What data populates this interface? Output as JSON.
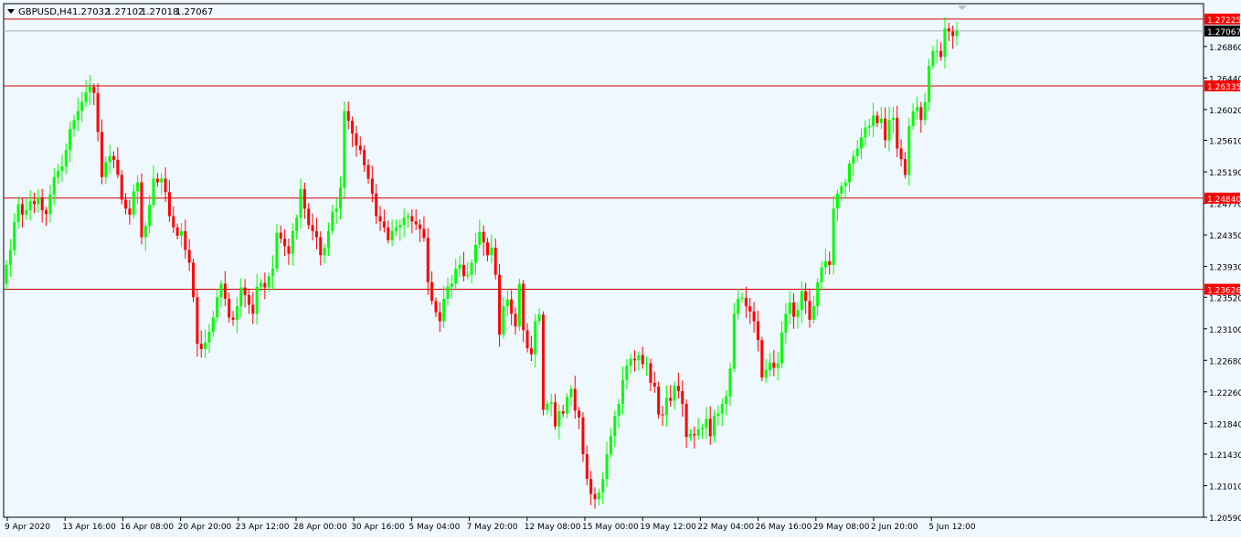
{
  "colors": {
    "background": "#F0F8FF",
    "frame": "#000000",
    "bull": "#00FF00",
    "bear": "#FF0000",
    "level_line": "#CC0000",
    "bid_line": "#B0B0B0",
    "text": "#000000"
  },
  "header": {
    "arrow_icon": "triangle-down-icon",
    "symbol": "GBPUSD,H4",
    "open": "1.27032",
    "high": "1.27102",
    "low": "1.27018",
    "close": "1.27067"
  },
  "chart_data": {
    "type": "candlestick",
    "symbol": "GBPUSD",
    "timeframe": "H4",
    "ylim": [
      1.2059,
      1.2743
    ],
    "y_ticks": [
      "1.26860",
      "1.26440",
      "1.26020",
      "1.25610",
      "1.25190",
      "1.24770",
      "1.24350",
      "1.23930",
      "1.23520",
      "1.23100",
      "1.22680",
      "1.22260",
      "1.21840",
      "1.21430",
      "1.21010",
      "1.20590"
    ],
    "x_labels": [
      "9 Apr 2020",
      "13 Apr 16:00",
      "16 Apr 08:00",
      "20 Apr 20:00",
      "23 Apr 12:00",
      "28 Apr 00:00",
      "30 Apr 16:00",
      "5 May 04:00",
      "7 May 20:00",
      "12 May 08:00",
      "15 May 00:00",
      "19 May 12:00",
      "22 May 04:00",
      "26 May 16:00",
      "29 May 08:00",
      "2 Jun 20:00",
      "5 Jun 12:00"
    ],
    "horizontal_levels": [
      "1.27225",
      "1.26335",
      "1.24840",
      "1.23626"
    ],
    "current_price": "1.27067",
    "closes": [
      1.2395,
      1.2415,
      1.2452,
      1.2476,
      1.2462,
      1.2468,
      1.248,
      1.2476,
      1.2485,
      1.2468,
      1.2463,
      1.2489,
      1.2512,
      1.252,
      1.2526,
      1.2548,
      1.2576,
      1.2588,
      1.26,
      1.2612,
      1.2625,
      1.2632,
      1.2624,
      1.2572,
      1.2512,
      1.2532,
      1.254,
      1.2535,
      1.2515,
      1.2482,
      1.247,
      1.2462,
      1.2493,
      1.2505,
      1.2432,
      1.2447,
      1.2475,
      1.251,
      1.2505,
      1.251,
      1.2492,
      1.246,
      1.2445,
      1.2434,
      1.244,
      1.2415,
      1.2398,
      1.2352,
      1.229,
      1.2283,
      1.2292,
      1.2306,
      1.2325,
      1.2352,
      1.237,
      1.235,
      1.2325,
      1.2322,
      1.234,
      1.2365,
      1.2355,
      1.2342,
      1.233,
      1.2366,
      1.2371,
      1.2365,
      1.238,
      1.239,
      1.2438,
      1.243,
      1.242,
      1.241,
      1.244,
      1.2458,
      1.2496,
      1.247,
      1.2448,
      1.244,
      1.2432,
      1.2408,
      1.2418,
      1.244,
      1.2466,
      1.247,
      1.2498,
      1.26,
      1.2587,
      1.257,
      1.2554,
      1.2548,
      1.2528,
      1.251,
      1.249,
      1.246,
      1.2453,
      1.2445,
      1.2428,
      1.244,
      1.2445,
      1.2448,
      1.2458,
      1.246,
      1.2453,
      1.2449,
      1.2443,
      1.2431,
      1.2372,
      1.2347,
      1.2332,
      1.232,
      1.235,
      1.2366,
      1.237,
      1.239,
      1.2395,
      1.238,
      1.2382,
      1.2398,
      1.2422,
      1.2439,
      1.2425,
      1.2408,
      1.2418,
      1.2382,
      1.2302,
      1.234,
      1.2349,
      1.233,
      1.2313,
      1.237,
      1.2308,
      1.2284,
      1.2276,
      1.232,
      1.2329,
      1.2202,
      1.221,
      1.2212,
      1.218,
      1.22,
      1.2197,
      1.2219,
      1.223,
      1.2201,
      1.2192,
      1.2143,
      1.211,
      1.209,
      1.2083,
      1.2092,
      1.211,
      1.2143,
      1.2167,
      1.2194,
      1.221,
      1.2242,
      1.2261,
      1.227,
      1.2268,
      1.2275,
      1.2263,
      1.2264,
      1.2238,
      1.2233,
      1.2196,
      1.2195,
      1.2218,
      1.2214,
      1.2234,
      1.2227,
      1.221,
      1.2166,
      1.217,
      1.2168,
      1.2176,
      1.2178,
      1.219,
      1.2167,
      1.2194,
      1.2197,
      1.221,
      1.222,
      1.2257,
      1.233,
      1.235,
      1.2351,
      1.234,
      1.2333,
      1.232,
      1.2295,
      1.2245,
      1.2255,
      1.2265,
      1.2258,
      1.2264,
      1.2305,
      1.233,
      1.2345,
      1.2326,
      1.2335,
      1.236,
      1.2347,
      1.2322,
      1.234,
      1.2372,
      1.2392,
      1.24,
      1.2395,
      1.247,
      1.249,
      1.25,
      1.2505,
      1.253,
      1.254,
      1.255,
      1.2565,
      1.2578,
      1.258,
      1.2594,
      1.2584,
      1.259,
      1.2561,
      1.2588,
      1.2591,
      1.255,
      1.2536,
      1.2515,
      1.258,
      1.26,
      1.2605,
      1.2588,
      1.2612,
      1.266,
      1.268,
      1.268,
      1.2672,
      1.271,
      1.2706,
      1.27,
      1.2707
    ]
  }
}
